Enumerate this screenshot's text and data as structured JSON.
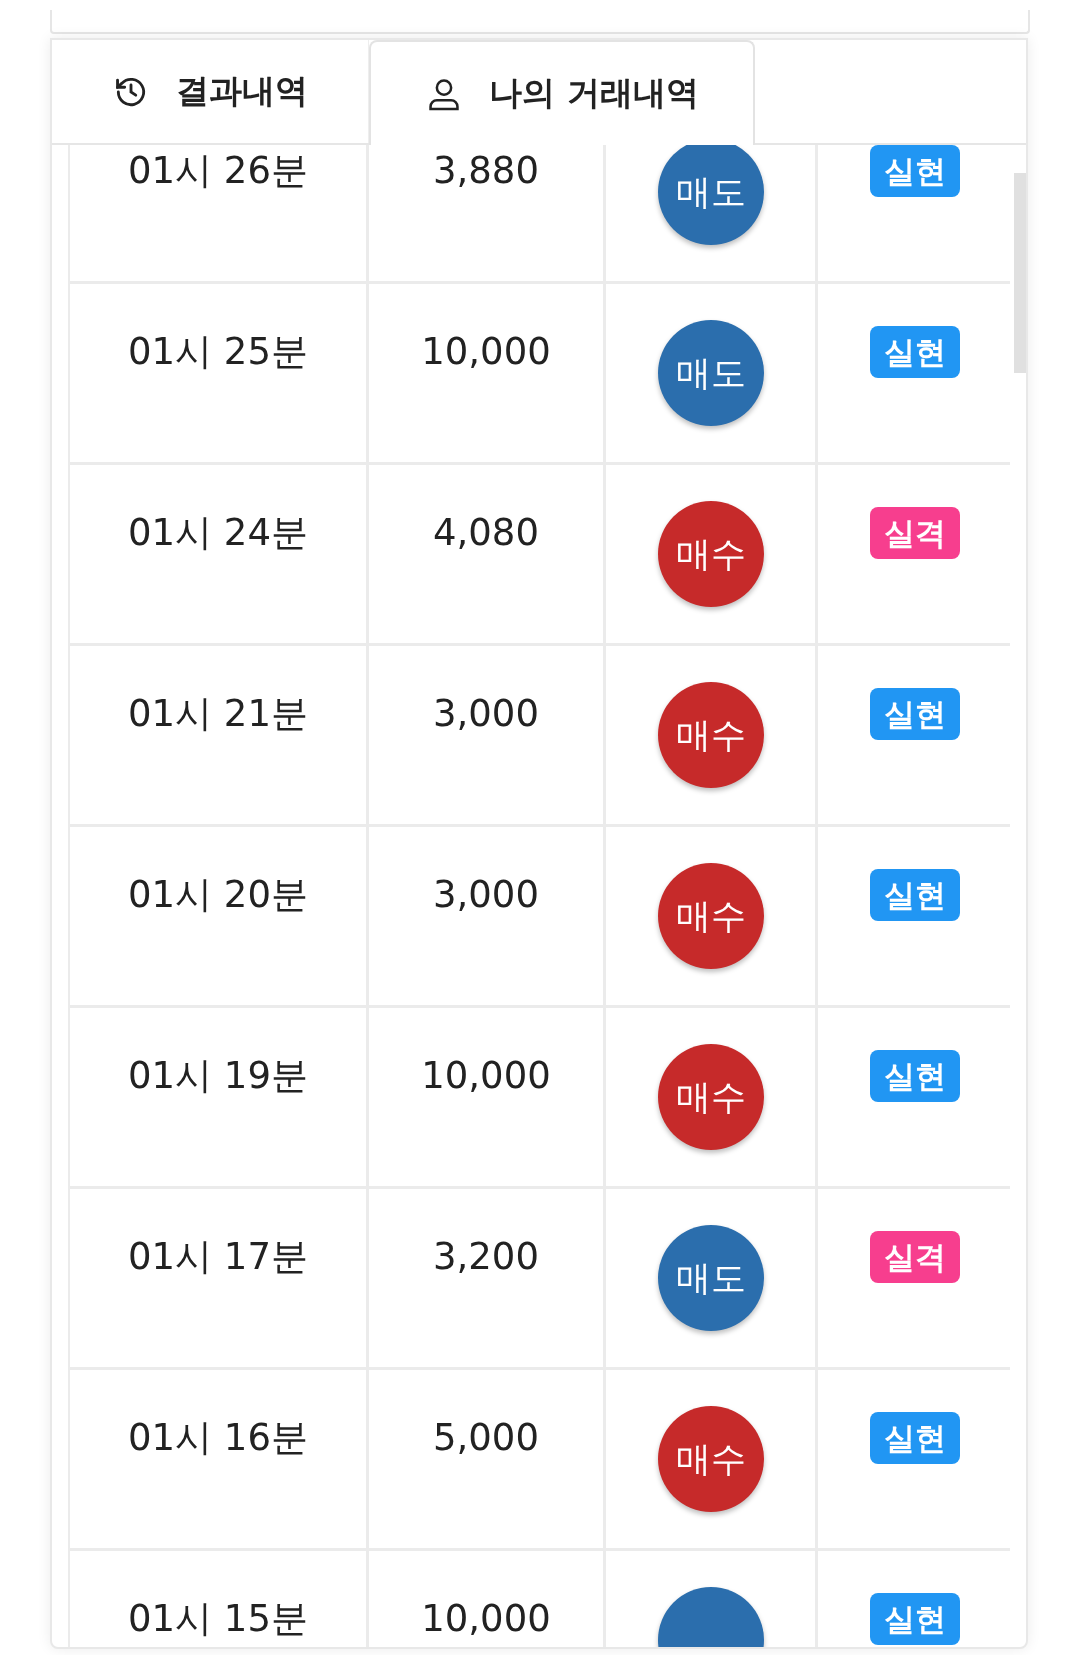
{
  "tabs": [
    {
      "label": "결과내역",
      "kind": "history",
      "selected": false
    },
    {
      "label": "나의 거래내역",
      "kind": "user",
      "selected": true
    }
  ],
  "rows": [
    {
      "time": "01시 26분",
      "amount": "3,880",
      "side": {
        "kind": "sell",
        "label": "매도"
      },
      "result": {
        "kind": "win",
        "label": "실현"
      }
    },
    {
      "time": "01시 25분",
      "amount": "10,000",
      "side": {
        "kind": "sell",
        "label": "매도"
      },
      "result": {
        "kind": "win",
        "label": "실현"
      }
    },
    {
      "time": "01시 24분",
      "amount": "4,080",
      "side": {
        "kind": "buy",
        "label": "매수"
      },
      "result": {
        "kind": "loss",
        "label": "실격"
      }
    },
    {
      "time": "01시 21분",
      "amount": "3,000",
      "side": {
        "kind": "buy",
        "label": "매수"
      },
      "result": {
        "kind": "win",
        "label": "실현"
      }
    },
    {
      "time": "01시 20분",
      "amount": "3,000",
      "side": {
        "kind": "buy",
        "label": "매수"
      },
      "result": {
        "kind": "win",
        "label": "실현"
      }
    },
    {
      "time": "01시 19분",
      "amount": "10,000",
      "side": {
        "kind": "buy",
        "label": "매수"
      },
      "result": {
        "kind": "win",
        "label": "실현"
      }
    },
    {
      "time": "01시 17분",
      "amount": "3,200",
      "side": {
        "kind": "sell",
        "label": "매도"
      },
      "result": {
        "kind": "loss",
        "label": "실격"
      }
    },
    {
      "time": "01시 16분",
      "amount": "5,000",
      "side": {
        "kind": "buy",
        "label": "매수"
      },
      "result": {
        "kind": "win",
        "label": "실현"
      }
    },
    {
      "time": "01시 15분",
      "amount": "10,000",
      "side": {
        "kind": "sell"
      },
      "result": {
        "kind": "win",
        "label": "실현"
      }
    }
  ]
}
